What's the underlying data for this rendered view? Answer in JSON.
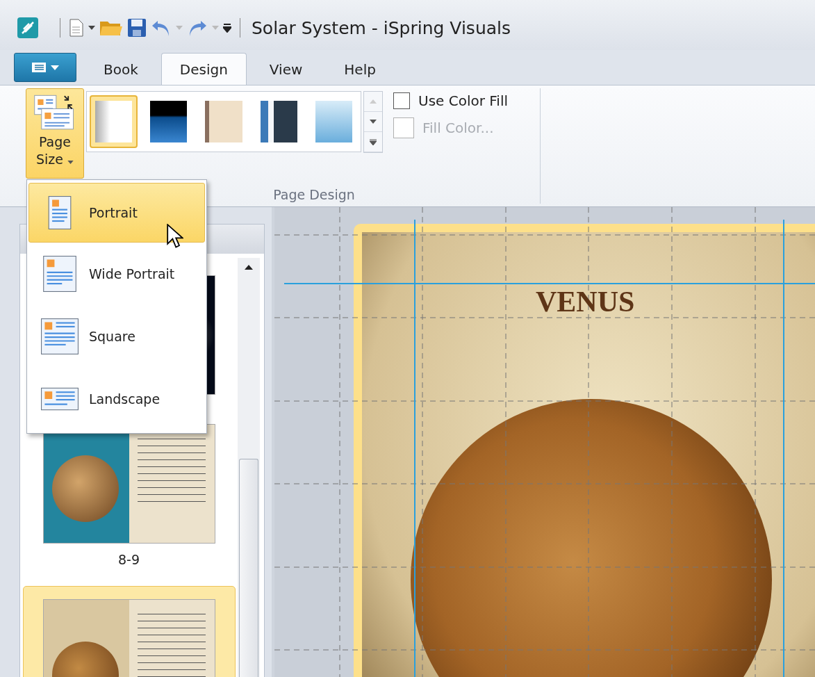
{
  "window": {
    "title": "Solar System - iSpring Visuals"
  },
  "tabs": [
    {
      "label": "Book",
      "selected": false
    },
    {
      "label": "Design",
      "selected": true
    },
    {
      "label": "View",
      "selected": false
    },
    {
      "label": "Help",
      "selected": false
    }
  ],
  "ribbon": {
    "page_size": {
      "label": "Page Size",
      "pressed": true
    },
    "themes": [
      {
        "kind": "plain",
        "selected": true
      },
      {
        "kind": "ocean",
        "selected": false
      },
      {
        "kind": "lattice",
        "selected": false
      },
      {
        "kind": "cityphoto",
        "selected": false
      },
      {
        "kind": "skyline",
        "selected": false
      }
    ],
    "options": [
      {
        "kind": "checkbox",
        "label": "Use Color Fill",
        "checked": false,
        "disabled": false
      },
      {
        "kind": "swatch",
        "label": "Fill Color...",
        "disabled": true
      }
    ],
    "group_label": "Page Design"
  },
  "page_size_menu": [
    {
      "kind": "portrait",
      "label": "Portrait",
      "selected": true
    },
    {
      "kind": "wide",
      "label": "Wide Portrait",
      "selected": false
    },
    {
      "kind": "square",
      "label": "Square",
      "selected": false
    },
    {
      "kind": "landscape",
      "label": "Landscape",
      "selected": false
    }
  ],
  "thumbnails": [
    {
      "kind": "space",
      "selected": false
    },
    {
      "kind": "mercury",
      "label": "8-9",
      "selected": false
    },
    {
      "kind": "venus",
      "selected": true
    }
  ],
  "canvas": {
    "page_title": "VENUS"
  }
}
